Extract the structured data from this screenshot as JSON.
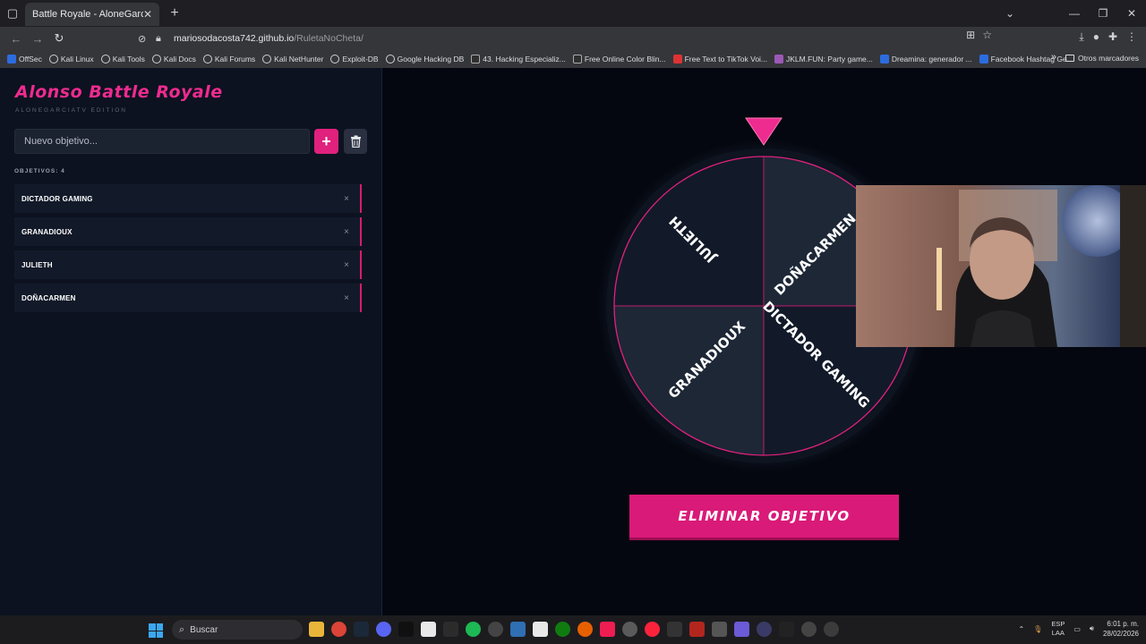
{
  "browser": {
    "tab_title": "Battle Royale - AloneGarciatv",
    "tab_close": "✕",
    "new_tab": "+",
    "url_host": "mariosodacosta742.github.io",
    "url_path": "/RuletaNoCheta/",
    "bookmarks": [
      "OffSec",
      "Kali Linux",
      "Kali Tools",
      "Kali Docs",
      "Kali Forums",
      "Kali NetHunter",
      "Exploit-DB",
      "Google Hacking DB",
      "43. Hacking Especializ...",
      "Free Online Color Blin...",
      "Free Text to TikTok Voi...",
      "JKLM.FUN: Party game...",
      "Dreamina: generador ...",
      "Facebook Hashtag Ge..."
    ],
    "other_bookmarks": "Otros marcadores"
  },
  "app": {
    "title": "Alonso Battle Royale",
    "subtitle": "ALONEGARCIATV EDITION",
    "input_placeholder": "Nuevo objetivo...",
    "add_label": "+",
    "count_label": "OBJETIVOS: 4",
    "targets": [
      {
        "name": "DICTADOR GAMING",
        "remove": "×"
      },
      {
        "name": "GRANADIOUX",
        "remove": "×"
      },
      {
        "name": "JULIETH",
        "remove": "×"
      },
      {
        "name": "DOÑACARMEN",
        "remove": "×"
      }
    ],
    "wheel_labels": [
      "JULIETH",
      "DOÑACARMEN",
      "DICTADOR GAMING",
      "GRANADIOUX"
    ],
    "spin_button": "ELIMINAR OBJETIVO"
  },
  "colors": {
    "accent": "#e0217d",
    "wheel_dark": "#121a29",
    "wheel_light": "#1d2736"
  },
  "taskbar": {
    "search_label": "Buscar",
    "lang_line1": "ESP",
    "lang_line2": "LAA",
    "time": "6:01 p. m.",
    "date": "28/02/2026"
  }
}
